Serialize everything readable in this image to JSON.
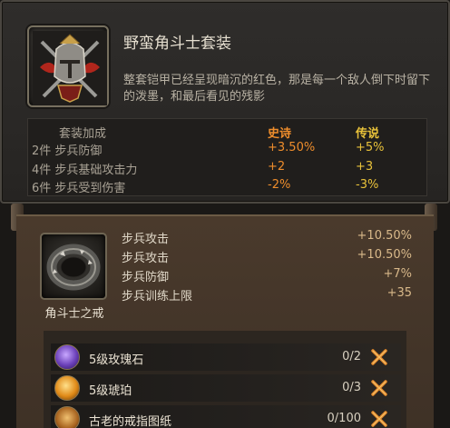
{
  "set": {
    "title": "野蛮角斗士套装",
    "description": "整套铠甲已经呈现暗沉的红色，那是每一个敌人倒下时留下的泼墨，和最后看见的残影",
    "table": {
      "header": [
        "套装加成",
        "史诗",
        "传说"
      ],
      "rows": [
        {
          "label": "2件 步兵防御",
          "epic": "+3.50%",
          "legend": "+5%"
        },
        {
          "label": "4件 步兵基础攻击力",
          "epic": "+2",
          "legend": "+3"
        },
        {
          "label": "6件 步兵受到伤害",
          "epic": "-2%",
          "legend": "-3%"
        }
      ]
    },
    "icon": "gladiator-helmet-crest-icon"
  },
  "item": {
    "name": "角斗士之戒",
    "icon": "ring-icon",
    "stats": [
      {
        "label": "步兵攻击",
        "value": "+10.50%"
      },
      {
        "label": "步兵攻击",
        "value": "+10.50%"
      },
      {
        "label": "步兵防御",
        "value": "+7%"
      },
      {
        "label": "步兵训练上限",
        "value": "+35"
      }
    ]
  },
  "materials": [
    {
      "name": "5级玫瑰石",
      "qty": "0/2",
      "icon": "rose-gem-icon",
      "status_icon": "cross-icon"
    },
    {
      "name": "5级琥珀",
      "qty": "0/3",
      "icon": "amber-gem-icon",
      "status_icon": "cross-icon"
    },
    {
      "name": "古老的戒指图纸",
      "qty": "0/100",
      "icon": "ring-blueprint-icon",
      "status_icon": "cross-icon"
    }
  ],
  "colors": {
    "epic": "#ee8d2c",
    "legendary": "#e9c23a",
    "cross": "#e0862a"
  }
}
